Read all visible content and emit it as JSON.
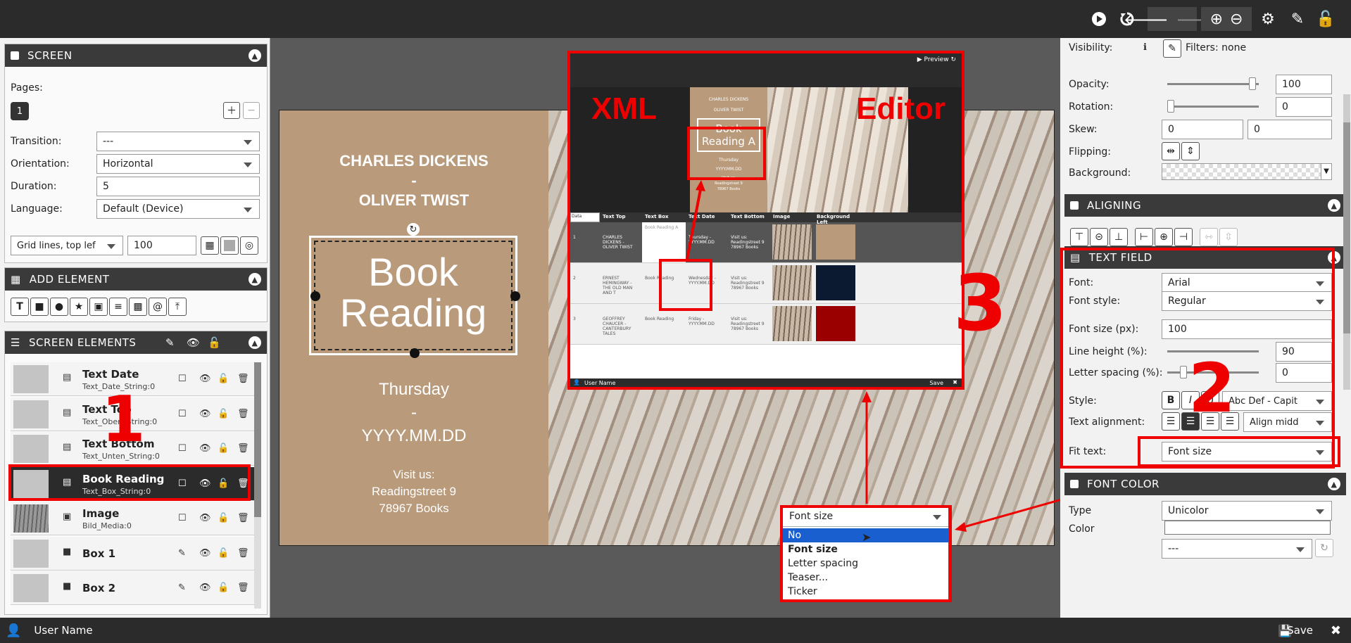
{
  "screen_panel": {
    "title": "SCREEN",
    "pages_label": "Pages:",
    "page_number": "1",
    "transition_label": "Transition:",
    "transition_value": "---",
    "orientation_label": "Orientation:",
    "orientation_value": "Horizontal",
    "duration_label": "Duration:",
    "duration_value": "5",
    "language_label": "Language:",
    "language_value": "Default (Device)",
    "grid_value": "Grid lines, top lef",
    "grid_size": "100"
  },
  "add_element": {
    "title": "ADD ELEMENT"
  },
  "screen_elements": {
    "title": "SCREEN ELEMENTS",
    "items": [
      {
        "name": "Text Date",
        "sub": "Text_Date_String:0"
      },
      {
        "name": "Text Top",
        "sub": "Text_Oben_String:0"
      },
      {
        "name": "Text Bottom",
        "sub": "Text_Unten_String:0"
      },
      {
        "name": "Book Reading",
        "sub": "Text_Box_String:0"
      },
      {
        "name": "Image",
        "sub": "Bild_Media:0"
      },
      {
        "name": "Box 1",
        "sub": ""
      },
      {
        "name": "Box 2",
        "sub": ""
      }
    ]
  },
  "preview": {
    "title_line1": "CHARLES DICKENS",
    "dash1": "-",
    "title_line2": "OLIVER TWIST",
    "book_line1": "Book",
    "book_line2": "Reading",
    "date_line1": "Thursday",
    "dash2": "-",
    "date_line2": "YYYY.MM.DD",
    "visit1": "Visit us:",
    "visit2": "Readingstreet 9",
    "visit3": "78967 Books"
  },
  "editor_inset": {
    "preview_label": "Preview",
    "xml_label": "XML",
    "editor_label": "Editor",
    "thumb_title1": "CHARLES DICKENS",
    "thumb_title2": "OLIVER TWIST",
    "thumb_book": "Book Reading A",
    "thumb_date1": "Thursday",
    "thumb_date2": "YYYY.MM.DD",
    "thumb_visit1": "Visit us:",
    "thumb_visit2": "Readingstreet 9",
    "thumb_visit3": "78967 Books",
    "data_select": "Data",
    "columns": [
      "Text Top",
      "Text Box",
      "Text Date",
      "Text Bottom",
      "Image",
      "Background Left"
    ],
    "rows": [
      {
        "num": "1",
        "top": "CHARLES DICKENS - OLIVER TWIST",
        "box": "Book Reading A",
        "date": "Thursday - YYYY.MM.DD",
        "bottom": "Visit us: Readingstreet 9 78967 Books",
        "bg": "#b99a7b"
      },
      {
        "num": "2",
        "top": "ERNEST HEMINGWAY - THE OLD MAN AND T",
        "box": "Book Reading",
        "date": "Wednesday - YYYY.MM.DD",
        "bottom": "Visit us: Readingstreet 9 78967 Books",
        "bg": "#0b1a30"
      },
      {
        "num": "3",
        "top": "GEOFFREY CHAUCER - CANTERBURY TALES",
        "box": "Book Reading",
        "date": "Friday - YYYY.MM.DD",
        "bottom": "Visit us: Readingstreet 9 78967 Books",
        "bg": "#9a0000"
      }
    ],
    "user": "User Name",
    "save": "Save"
  },
  "dropdown": {
    "current": "Font size",
    "options": [
      "No",
      "Font size",
      "Letter spacing",
      "Teaser...",
      "Ticker"
    ],
    "selected_index": 1
  },
  "annotations": {
    "one": "1",
    "two": "2",
    "three": "3"
  },
  "right": {
    "visibility_label": "Visibility:",
    "filters": "Filters: none",
    "opacity_label": "Opacity:",
    "opacity_value": "100",
    "rotation_label": "Rotation:",
    "rotation_value": "0",
    "skew_label": "Skew:",
    "skew_x": "0",
    "skew_y": "0",
    "flipping_label": "Flipping:",
    "background_label": "Background:",
    "aligning_title": "ALIGNING",
    "textfield_title": "TEXT FIELD",
    "font_label": "Font:",
    "font_value": "Arial",
    "fontstyle_label": "Font style:",
    "fontstyle_value": "Regular",
    "fontsize_label": "Font size (px):",
    "fontsize_value": "100",
    "lineheight_label": "Line height (%):",
    "lineheight_value": "90",
    "letterspacing_label": "Letter spacing (%):",
    "letterspacing_value": "0",
    "style_label": "Style:",
    "case_value": "Abc Def - Capit",
    "align_label": "Text alignment:",
    "valign_value": "Align midd",
    "fit_label": "Fit text:",
    "fit_value": "Font size",
    "fontcolor_title": "FONT COLOR",
    "type_label": "Type",
    "type_value": "Unicolor",
    "color_label": "Color",
    "extra_value": "---"
  },
  "bottom": {
    "user": "User Name",
    "save": "Save"
  }
}
